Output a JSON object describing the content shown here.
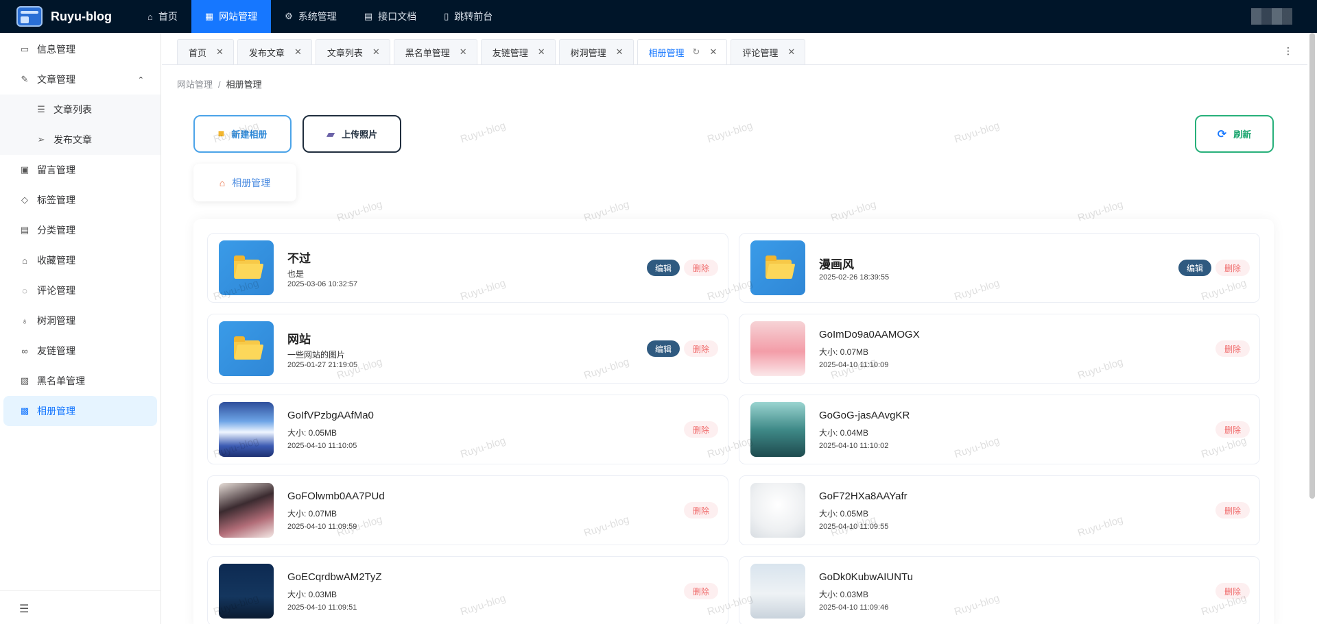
{
  "app": {
    "name": "Ruyu-blog"
  },
  "topnav": [
    {
      "label": "首页",
      "icon": "home-icon",
      "glyph": "⌂",
      "active": false
    },
    {
      "label": "网站管理",
      "icon": "grid-icon",
      "glyph": "▦",
      "active": true
    },
    {
      "label": "系统管理",
      "icon": "gear-icon",
      "glyph": "⚙",
      "active": false
    },
    {
      "label": "接口文档",
      "icon": "document-icon",
      "glyph": "▤",
      "active": false
    },
    {
      "label": "跳转前台",
      "icon": "page-icon",
      "glyph": "▯",
      "active": false
    }
  ],
  "sidebar": {
    "items": [
      {
        "label": "信息管理",
        "icon": "info-card-icon",
        "glyph": "▭"
      },
      {
        "label": "文章管理",
        "icon": "edit-icon",
        "glyph": "✎"
      },
      {
        "label": "文章列表",
        "icon": "list-icon",
        "glyph": "☰"
      },
      {
        "label": "发布文章",
        "icon": "send-icon",
        "glyph": "➢"
      },
      {
        "label": "留言管理",
        "icon": "message-icon",
        "glyph": "▣"
      },
      {
        "label": "标签管理",
        "icon": "tag-icon",
        "glyph": "◇"
      },
      {
        "label": "分类管理",
        "icon": "category-icon",
        "glyph": "▤"
      },
      {
        "label": "收藏管理",
        "icon": "collect-icon",
        "glyph": "⌂"
      },
      {
        "label": "评论管理",
        "icon": "comment-icon",
        "glyph": "◌"
      },
      {
        "label": "树洞管理",
        "icon": "bulb-icon",
        "glyph": "♁"
      },
      {
        "label": "友链管理",
        "icon": "link-icon",
        "glyph": "∞"
      },
      {
        "label": "黑名单管理",
        "icon": "blacklist-icon",
        "glyph": "▨"
      },
      {
        "label": "相册管理",
        "icon": "image-icon",
        "glyph": "▩"
      }
    ],
    "collapse_glyph": "☰"
  },
  "tabs": [
    {
      "label": "首页",
      "active": false
    },
    {
      "label": "发布文章",
      "active": false
    },
    {
      "label": "文章列表",
      "active": false
    },
    {
      "label": "黑名单管理",
      "active": false
    },
    {
      "label": "友链管理",
      "active": false
    },
    {
      "label": "树洞管理",
      "active": false
    },
    {
      "label": "相册管理",
      "active": true
    },
    {
      "label": "评论管理",
      "active": false
    }
  ],
  "tab_close": "✕",
  "tab_refresh": "↻",
  "more": "⋮",
  "breadcrumb": {
    "parent": "网站管理",
    "sep": "/",
    "current": "相册管理"
  },
  "actions": {
    "new_album": "新建相册",
    "upload": "上传照片",
    "refresh": "刷新",
    "manage": "相册管理"
  },
  "buttons": {
    "edit": "编辑",
    "delete": "删除"
  },
  "albums": [
    {
      "name": "不过",
      "desc": "也是",
      "time": "2025-03-06 10:32:57"
    },
    {
      "name": "漫画风",
      "desc": "",
      "time": "2025-02-26 18:39:55"
    },
    {
      "name": "网站",
      "desc": "一些网站的图片",
      "time": "2025-01-27 21:19:05"
    }
  ],
  "photos": [
    {
      "name": "GoImDo9a0AAMOGX",
      "size": "大小: 0.07MB",
      "time": "2025-04-10 11:10:09"
    },
    {
      "name": "GoIfVPzbgAAfMa0",
      "size": "大小: 0.05MB",
      "time": "2025-04-10 11:10:05"
    },
    {
      "name": "GoGoG-jasAAvgKR",
      "size": "大小: 0.04MB",
      "time": "2025-04-10 11:10:02"
    },
    {
      "name": "GoFOlwmb0AA7PUd",
      "size": "大小: 0.07MB",
      "time": "2025-04-10 11:09:59"
    },
    {
      "name": "GoF72HXa8AAYafr",
      "size": "大小: 0.05MB",
      "time": "2025-04-10 11:09:55"
    },
    {
      "name": "GoECqrdbwAM2TyZ",
      "size": "大小: 0.03MB",
      "time": "2025-04-10 11:09:51"
    },
    {
      "name": "GoDk0KubwAIUNTu",
      "size": "大小: 0.03MB",
      "time": "2025-04-10 11:09:46"
    }
  ],
  "watermark": "Ruyu-blog",
  "colors": {
    "topbar": "#001529",
    "accent": "#1677ff",
    "edit": "#2f5a80",
    "delete": "#f06b6b"
  }
}
